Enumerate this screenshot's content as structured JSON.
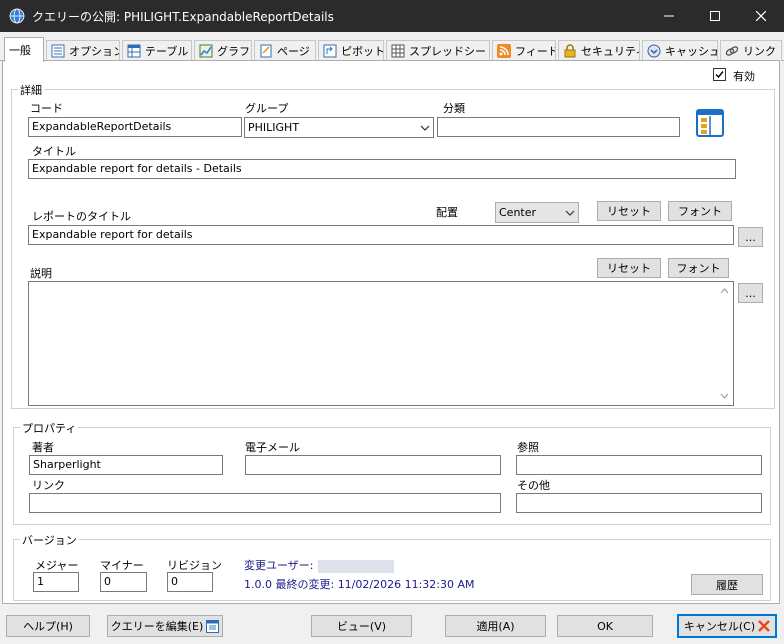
{
  "window": {
    "title": "クエリーの公開: PHILIGHT.ExpandableReportDetails"
  },
  "tabs": [
    {
      "label": "一般",
      "icon": "general"
    },
    {
      "label": "オプション",
      "icon": "options-icon"
    },
    {
      "label": "テーブル",
      "icon": "table-icon"
    },
    {
      "label": "グラフ",
      "icon": "chart-icon"
    },
    {
      "label": "ページ",
      "icon": "page-icon"
    },
    {
      "label": "ピボット",
      "icon": "pivot-icon"
    },
    {
      "label": "スプレッドシート",
      "icon": "spreadsheet-icon"
    },
    {
      "label": "フィード",
      "icon": "rss-feed-icon"
    },
    {
      "label": "セキュリティ",
      "icon": "lock-icon"
    },
    {
      "label": "キャッシュ",
      "icon": "cache-icon"
    },
    {
      "label": "リンク",
      "icon": "link-icon"
    }
  ],
  "enabled": {
    "label": "有効",
    "checked": true
  },
  "details": {
    "legend": "詳細",
    "code": {
      "label": "コード",
      "value": "ExpandableReportDetails"
    },
    "group": {
      "label": "グループ",
      "value": "PHILIGHT"
    },
    "category": {
      "label": "分類",
      "value": ""
    },
    "title": {
      "label": "タイトル",
      "value": "Expandable report for details - Details"
    },
    "report_title": {
      "label": "レポートのタイトル",
      "value": "Expandable report for details",
      "align_label": "配置",
      "align_value": "Center",
      "reset": "リセット",
      "font": "フォント",
      "ellipsis": "..."
    },
    "description": {
      "label": "説明",
      "value": "",
      "reset": "リセット",
      "font": "フォント",
      "ellipsis": "..."
    }
  },
  "properties": {
    "legend": "プロパティ",
    "author": {
      "label": "著者",
      "value": "Sharperlight"
    },
    "email": {
      "label": "電子メール",
      "value": ""
    },
    "reference": {
      "label": "参照",
      "value": ""
    },
    "link": {
      "label": "リンク",
      "value": ""
    },
    "other": {
      "label": "その他",
      "value": ""
    }
  },
  "version": {
    "legend": "バージョン",
    "major": {
      "label": "メジャー",
      "value": "1"
    },
    "minor": {
      "label": "マイナー",
      "value": "0"
    },
    "revision": {
      "label": "リビジョン",
      "value": "0"
    },
    "changed_user_label": "変更ユーザー:",
    "last_changed": "1.0.0 最終の変更: 11/02/2026 11:32:30 AM",
    "history": "履歴"
  },
  "footer": {
    "help": "ヘルプ(H)",
    "edit_query": "クエリーを編集(E)",
    "view": "ビュー(V)",
    "apply": "適用(A)",
    "ok": "OK",
    "cancel": "キャンセル(C)"
  },
  "colors": {
    "titlebar": "#2b2b2b",
    "accent": "#0078d7",
    "link": "#1a1a8c",
    "cancel_x": "#e8471a"
  }
}
